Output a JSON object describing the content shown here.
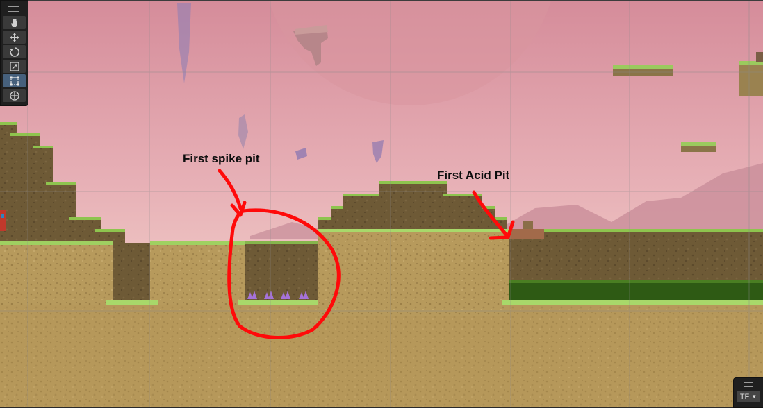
{
  "scene_view": {
    "annotations": {
      "spike_pit_label": "First spike pit",
      "acid_pit_label": "First Acid Pit"
    },
    "annotation_color": "#ff0a0a"
  },
  "toolbar": {
    "tools": [
      {
        "name": "hand-tool",
        "icon": "hand-icon"
      },
      {
        "name": "move-tool",
        "icon": "move-icon"
      },
      {
        "name": "rotate-tool",
        "icon": "rotate-icon"
      },
      {
        "name": "scale-tool",
        "icon": "scale-icon"
      },
      {
        "name": "rect-tool",
        "icon": "rect-transform-icon",
        "active": true
      },
      {
        "name": "transform-tool",
        "icon": "transform-icon"
      }
    ]
  },
  "overlay_menu": {
    "dropdown_label": "TF",
    "icon": "chevron-down-icon"
  },
  "colors": {
    "sky_top": "#d9909c",
    "sky_bottom": "#ecc2c2",
    "ground": "#b79a5c",
    "grass": "#8ec44e",
    "acid": "#2e5a14",
    "spikes": "#a572d8"
  }
}
